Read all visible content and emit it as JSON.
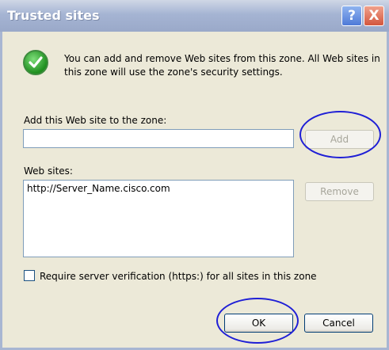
{
  "window": {
    "title": "Trusted sites",
    "help_glyph": "?",
    "close_glyph": "X"
  },
  "info": {
    "icon": "green-checkmark-icon",
    "message": "You can add and remove Web sites from this zone. All Web sites in this zone will use the zone's security settings."
  },
  "add_site": {
    "label": "Add this Web site to the zone:",
    "value": "",
    "button": "Add"
  },
  "websites": {
    "label": "Web sites:",
    "items": [
      "http://Server_Name.cisco.com"
    ],
    "remove_button": "Remove"
  },
  "require_https": {
    "checked": false,
    "label": "Require server verification (https:) for all sites in this zone"
  },
  "footer": {
    "ok": "OK",
    "cancel": "Cancel"
  },
  "colors": {
    "annotation_circle": "#1f1fd6",
    "titlebar": "#a5b4d3",
    "dialog_bg": "#ece9d8"
  }
}
